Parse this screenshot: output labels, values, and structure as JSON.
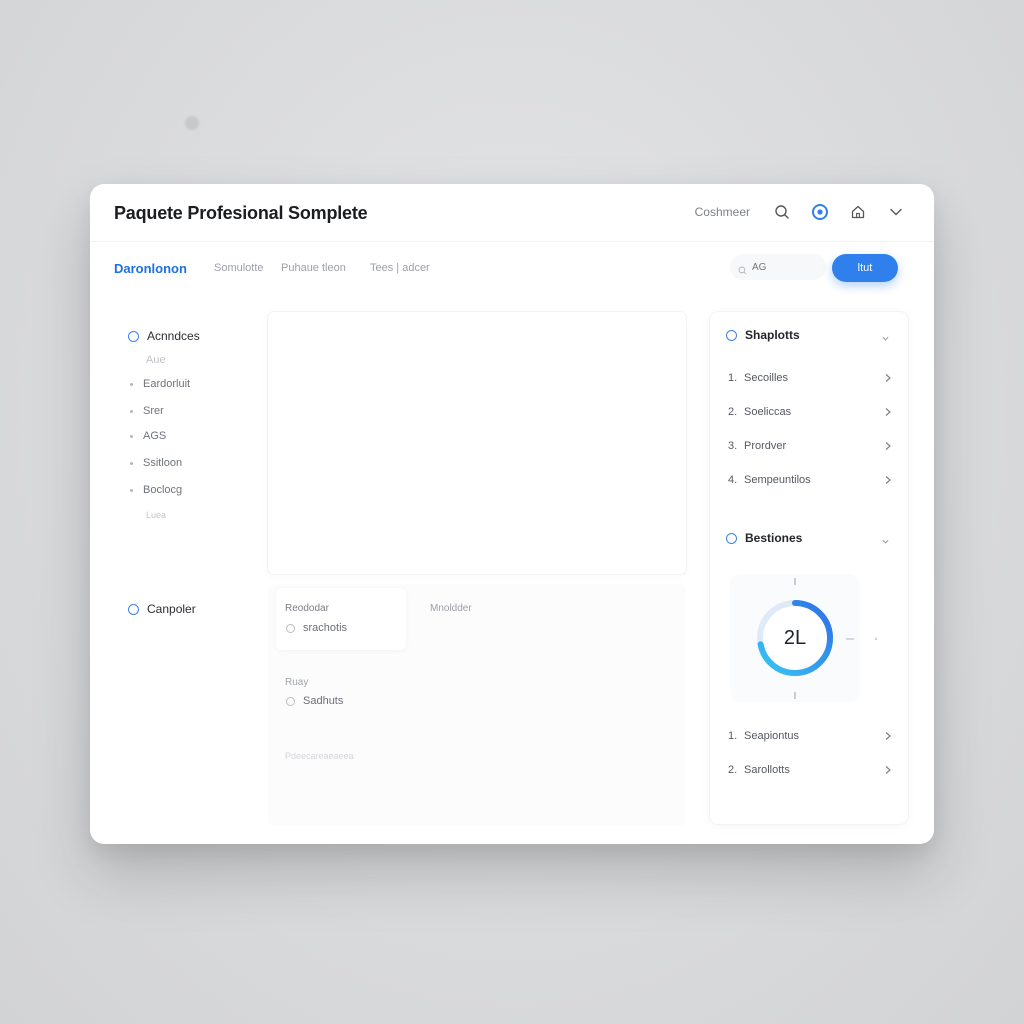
{
  "window": {
    "title": "Paquete Profesional Somplete"
  },
  "header": {
    "user_label": "Coshmeer",
    "icons": [
      "search-icon",
      "settings-icon",
      "home-icon",
      "chevron-down-icon"
    ]
  },
  "tabs": {
    "active": "Daronlonon",
    "items": [
      "Somulotte",
      "Puhaue tleon",
      "Tees | adcer"
    ]
  },
  "search": {
    "placeholder": "AG"
  },
  "primary_button": {
    "label": "ltut"
  },
  "sidebar": {
    "section1": {
      "title": "Acnndces",
      "items": [
        "Aue",
        "Eardorluit",
        "Srer",
        "AGS",
        "Ssitloon",
        "Boclocg",
        "Luea"
      ]
    },
    "section2": {
      "title": "Canpoler"
    }
  },
  "form": {
    "label1": "Reododar",
    "label2": "Mnoldder",
    "option1": "srachotis",
    "label3": "Ruay",
    "option2": "Sadhuts",
    "footer_faint": "Pdeecareaeaeea"
  },
  "right_panel": {
    "section1": {
      "title": "Shaplotts",
      "rows": [
        {
          "num": "1.",
          "label": "Secoilles"
        },
        {
          "num": "2.",
          "label": "Soeliccas"
        },
        {
          "num": "3.",
          "label": "Prordver"
        },
        {
          "num": "4.",
          "label": "Sempeuntilos"
        }
      ]
    },
    "section2": {
      "title": "Bestiones",
      "gauge_value": "2L",
      "gauge_fraction": 0.72,
      "rows": [
        {
          "num": "1.",
          "label": "Seapiontus"
        },
        {
          "num": "2.",
          "label": "Sarollotts"
        }
      ]
    }
  },
  "colors": {
    "accent": "#2f80ed",
    "accent_light": "#38c6f4",
    "bg": "#dcdddf"
  }
}
